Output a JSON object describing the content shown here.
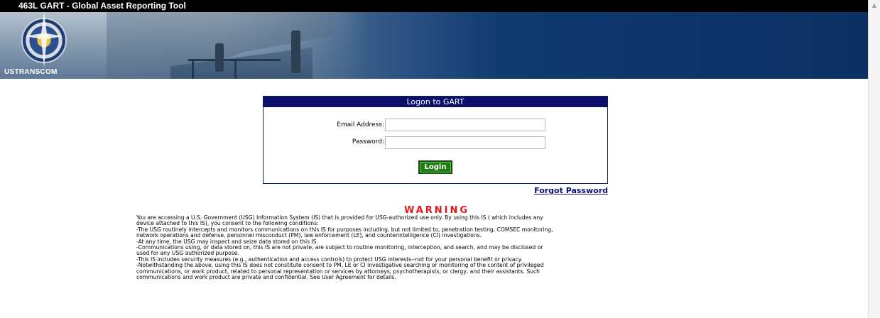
{
  "window": {
    "title": "463L GART - Global Asset Reporting Tool"
  },
  "banner": {
    "brand": "USTRANSCOM",
    "logo_icon": "ustranscom-seal-icon"
  },
  "login": {
    "header": "Logon to GART",
    "email_label": "Email Address:",
    "email_value": "",
    "password_label": "Password:",
    "password_value": "",
    "button_label": "Login",
    "button_color": "#1e7e14",
    "forgot_link": "Forgot Password"
  },
  "warning": {
    "title": "WARNING",
    "title_color": "#e01b1b",
    "lines": [
      "You are accessing a U.S. Government (USG) Information System (IS) that is provided for USG-authorized use only. By using this IS ( which includes any",
      "device attached to this IS), you consent to the following conditions:",
      "-The USG routinely intercepts and monitors communications on this IS for purposes including, but not limited to, penetration testing, COMSEC monitoring,",
      "network operations and defense, personnel misconduct (PM), law enforcement (LE), and counterintelligence (CI) investigations.",
      "-At any time, the USG may inspect and seize data stored on this IS.",
      "-Communications using, or data stored on, this IS are not private, are subject to routine monitoring, interception, and search, and may be disclosed or",
      "used for any USG authorized purpose.",
      "-This IS includes security measures (e.g., authentication and access controls) to protect USG interests--not for your personal benefit or privacy.",
      "-Notwithstanding the above, using this IS does not constitute consent to PM, LE or CI investigative searching or monitoring of the content of privileged",
      "communications, or work product, related to personal representation or services by attorneys, psychotherapists, or clergy, and their assistants. Such",
      "communications and work product are private and confidential. See User Agreement for details."
    ]
  },
  "colors": {
    "header_navy": "#0a0f6a",
    "banner_blue": "#0b3064"
  }
}
